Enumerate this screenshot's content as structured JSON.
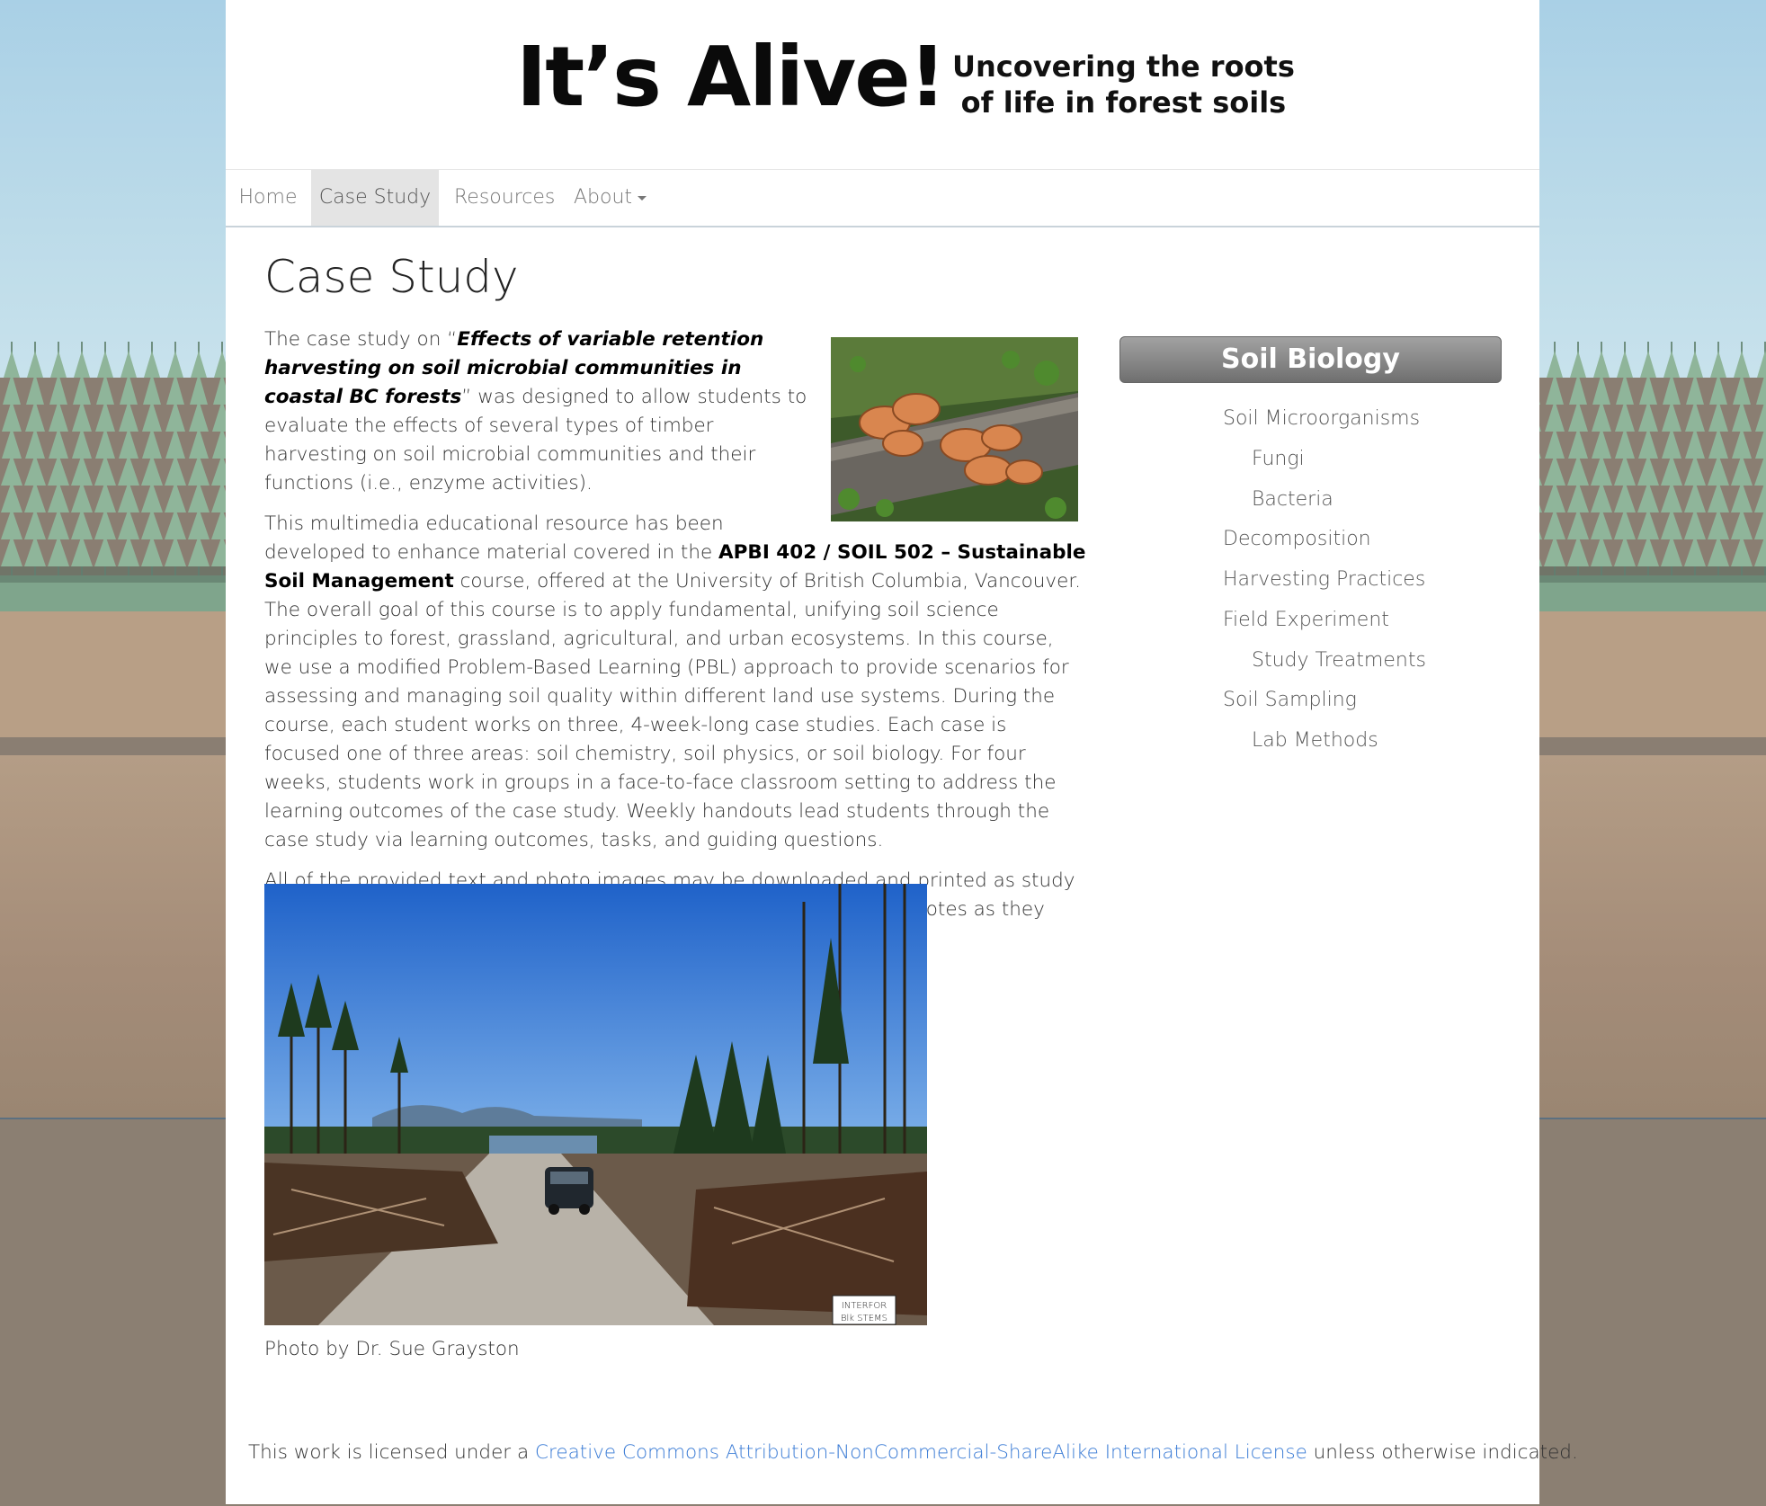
{
  "header": {
    "logo_title": "It’s Alive!",
    "logo_subtitle_line1": "Uncovering the roots",
    "logo_subtitle_line2": "of life in forest soils"
  },
  "nav": {
    "items": [
      {
        "label": "Home",
        "active": false
      },
      {
        "label": "Case Study",
        "active": true
      },
      {
        "label": "Resources",
        "active": false
      },
      {
        "label": "About",
        "active": false,
        "dropdown": true
      }
    ]
  },
  "main": {
    "title": "Case Study",
    "p1": {
      "pre": "The case study on “",
      "bold_title": "Effects of variable retention harvesting on soil microbial communities in coastal BC forests",
      "post": "” was designed to allow students to evaluate the effects of several types of timber harvesting on soil microbial communities and their functions (i.e., enzyme activities)."
    },
    "p2": {
      "pre": "This multimedia educational resource has been developed to enhance material covered in the ",
      "bold_course": "APBI 402 / SOIL 502 – Sustainable Soil Management",
      "post": " course, offered at the University of British Columbia, Vancouver. The overall goal of this course is to apply fundamental, unifying soil science principles to forest, grassland, agricultural, and urban ecosystems. In this course, we use a modified Problem-Based Learning (PBL) approach to provide scenarios for assessing and managing soil quality within different land use systems. During the course, each student works on three, 4-week-long case studies. Each case is focused one of three areas: soil chemistry, soil physics, or soil biology. For four weeks, students work in groups in a face-to-face classroom setting to address the learning outcomes of the case study. Weekly handouts lead students through the case study via learning outcomes, tasks, and guiding questions."
    },
    "p3": "All of the provided text and photo images may be downloaded and printed as study aids. Students are encouraged to print the video outlines and take notes as they watch the video clips.",
    "photo_caption": "Photo by Dr. Sue Grayston",
    "photo_sign_text": "INTERFOR",
    "photo_sign_text2": "Blk STEMS"
  },
  "sidebar": {
    "heading": "Soil Biology",
    "items": [
      {
        "label": "Soil Microorganisms",
        "level": 0
      },
      {
        "label": "Fungi",
        "level": 1
      },
      {
        "label": "Bacteria",
        "level": 1
      },
      {
        "label": "Decomposition",
        "level": 0
      },
      {
        "label": "Harvesting Practices",
        "level": 0
      },
      {
        "label": "Field Experiment",
        "level": 0
      },
      {
        "label": "Study Treatments",
        "level": 1
      },
      {
        "label": "Soil Sampling",
        "level": 0
      },
      {
        "label": "Lab Methods",
        "level": 1
      }
    ]
  },
  "footer": {
    "pre": "This work is licensed under a ",
    "link": "Creative Commons Attribution-NonCommercial-ShareAlike International License",
    "post": " unless otherwise indicated."
  },
  "colors": {
    "sky": "#a9d0e6",
    "soil": "#a48c78",
    "link": "#3a7bd5",
    "sidebar_heading": "#7d7d7d"
  }
}
